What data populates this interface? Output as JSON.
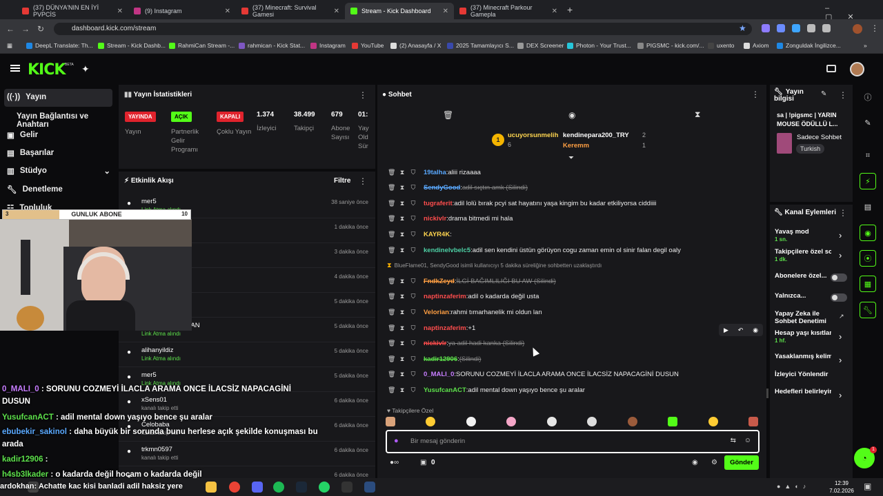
{
  "browser": {
    "tabs": [
      {
        "label": "(37) DÜNYA'NIN EN İYİ PVPCİS",
        "color": "#e53935"
      },
      {
        "label": "(9) Instagram",
        "color": "#c13584"
      },
      {
        "label": "(37) Minecraft: Survival Gamesi",
        "color": "#e53935"
      },
      {
        "label": "Stream - Kick Dashboard",
        "color": "#53fc18"
      },
      {
        "label": "(37) Minecraft Parkour Gamepla",
        "color": "#e53935"
      }
    ],
    "url": "dashboard.kick.com/stream",
    "bookmarks": [
      "DeepL Translate: Th...",
      "Stream - Kick Dashb...",
      "RahmiCan Stream -...",
      "rahmican - Kick Stat...",
      "Instagram",
      "YouTube",
      "(2) Anasayfa / X",
      "2025 Tamamlayıcı S...",
      "DEX Screener",
      "Photon - Your Trust...",
      "PIGSMC - kick.com/...",
      "uxento",
      "Axiom",
      "Zonguldak İngilizce..."
    ]
  },
  "kick": {
    "logo": "KICK",
    "beta": "BETA"
  },
  "nav": {
    "items": [
      "Yayın",
      "Yayın Bağlantısı ve Anahtarı",
      "Gelir",
      "Başarılar",
      "Stüdyo",
      "Denetleme",
      "Topluluk"
    ]
  },
  "overlay": {
    "goal_count": "3",
    "goal_label": "GUNLUK ABONE",
    "goal_target": "10",
    "goal_progress": 0.3
  },
  "stats": {
    "title": "Yayın İstatistikleri",
    "badges": [
      {
        "badge": "YAYINDA",
        "label": "Yayın"
      },
      {
        "badge": "AÇIK",
        "label": "Partnerlik Gelir Programı"
      },
      {
        "badge": "KAPALI",
        "label": "Çoklu Yayın"
      }
    ],
    "numbers": [
      {
        "value": "1.374",
        "label": "İzleyici"
      },
      {
        "value": "38.499",
        "label": "Takipçi"
      },
      {
        "value": "679",
        "label": "Abone Sayısı"
      },
      {
        "value": "01:",
        "label": "Yay Old Sür"
      }
    ]
  },
  "activity": {
    "title": "Etkinlik Akışı",
    "filter": "Filtre",
    "events": [
      {
        "name": "mer5",
        "sub": "Link Atma alındı",
        "time": "38 saniye önce"
      },
      {
        "name": "",
        "sub": "",
        "time": "1 dakika önce"
      },
      {
        "name": "",
        "sub": "",
        "time": "3 dakika önce"
      },
      {
        "name": "",
        "sub": "",
        "time": "4 dakika önce"
      },
      {
        "name": "",
        "sub": "",
        "time": "5 dakika önce"
      },
      {
        "name": "İNANUKLEERATAN",
        "sub": "Link Atma alındı",
        "time": "5 dakika önce"
      },
      {
        "name": "alihanyildiz",
        "sub": "Link Atma alındı",
        "time": "5 dakika önce"
      },
      {
        "name": "mer5",
        "sub": "Link Atma alındı",
        "time": "5 dakika önce"
      },
      {
        "name": "xSens01",
        "sub": "kanalı takip etti",
        "time": "6 dakika önce"
      },
      {
        "name": "Celobaba",
        "sub": "kanalı takip etti",
        "time": "6 dakika önce"
      },
      {
        "name": "trkmn0597",
        "sub": "kanalı takip etti",
        "time": "6 dakika önce"
      },
      {
        "name": "",
        "sub": "",
        "time": "6 dakika önce"
      }
    ]
  },
  "chat": {
    "title": "Sohbet",
    "pinned_left": {
      "name": "ucuyorsunmelih",
      "count": "6"
    },
    "pinned_right": [
      {
        "name": "kendinepara200_TRY",
        "count": "2"
      },
      {
        "name": "Keremm",
        "count": "1"
      }
    ],
    "messages": [
      {
        "user": "19talha",
        "color": "#5aa9ff",
        "text": "aliii rizaaaa",
        "deleted": false
      },
      {
        "user": "SendyGood",
        "color": "#5aa9ff",
        "text": "adil sıçtın amk (Silindi)",
        "deleted": true
      },
      {
        "user": "tugraferit",
        "color": "#ff4d4d",
        "text": "adil lolü bırak pcyi sat hayatını yaşa kingim bu kadar etkiliyorsa ciddiiii",
        "deleted": false
      },
      {
        "user": "nickivlr",
        "color": "#ff4d4d",
        "text": "drama bitmedi mi hala",
        "deleted": false
      },
      {
        "user": "KAYR4K",
        "color": "#ffd54f",
        "text": "",
        "deleted": false
      },
      {
        "user": "kendinelvbelc5",
        "color": "#4dd0a5",
        "text": "adil sen kendini üstün görüyon cogu zaman emin ol sinir falan degil oaly",
        "deleted": false
      },
      {
        "user": "",
        "color": "#aaa",
        "text": "BlueFlame01, SendyGood isimli kullanıcıyı 5 dakika süreliğine sohbetten uzaklaştırdı",
        "deleted": false
      },
      {
        "user": "FndkZeyd",
        "color": "#ff9f43",
        "text": "İLGİ BAĞIMLILIĞI BU AW (Silindi)",
        "deleted": true
      },
      {
        "user": "naptinzaferim",
        "color": "#ff4d4d",
        "text": "adil o kadarda değil usta",
        "deleted": false
      },
      {
        "user": "Velorian",
        "color": "#ff9f43",
        "text": "rahmi tımarhanelik mi oldun lan",
        "deleted": false
      },
      {
        "user": "naptinzaferim",
        "color": "#ff4d4d",
        "text": "+1",
        "deleted": false
      },
      {
        "user": "nickivlr",
        "color": "#ff4d4d",
        "text": "ya adil hadi kanka (Silindi)",
        "deleted": true
      },
      {
        "user": "kadir12906",
        "color": "#5de14b",
        "text": "(Silindi)",
        "deleted": true
      },
      {
        "user": "0_MALI_0",
        "color": "#c77dff",
        "text": "SORUNU COZMEYİ İLACLA ARAMA ONCE İLACSİZ NAPACAGİNİ DUSUN",
        "deleted": false
      },
      {
        "user": "YusufcanACT",
        "color": "#5de14b",
        "text": "adil mental down yaşıyo bence şu aralar",
        "deleted": false
      }
    ],
    "follower_label": "Takipçilere Özel",
    "input_placeholder": "Bir mesaj gönderin",
    "points": "0",
    "send_label": "Gönder"
  },
  "info": {
    "title": "Yayın bilgisi",
    "stream_title": "sa | !pigsmc | YARIN MOUSE ÖDÜLLÜ L...",
    "category": "Sadece Sohbet",
    "language": "Turkish"
  },
  "actions": {
    "title": "Kanal Eylemleri",
    "items": [
      {
        "label": "Yavaş mod",
        "sub": "1 sn.",
        "kind": "arrow"
      },
      {
        "label": "Takipçilere özel soh",
        "sub": "1 dk.",
        "kind": "arrow"
      },
      {
        "label": "Abonelere özel...",
        "sub": "",
        "kind": "toggle"
      },
      {
        "label": "Yalnızca...",
        "sub": "",
        "kind": "toggle"
      },
      {
        "label": "Yapay Zeka ile Sohbet Denetimi",
        "sub": "",
        "kind": "link"
      },
      {
        "label": "Hesap yaşı kısıtlama",
        "sub": "1 hf.",
        "kind": "arrow"
      },
      {
        "label": "Yasaklanmış kelimel",
        "sub": "",
        "kind": "arrow"
      },
      {
        "label": "İzleyici Yönlendir",
        "sub": "",
        "kind": "none"
      },
      {
        "label": "Hedefleri belirleyin",
        "sub": "",
        "kind": "arrow"
      }
    ]
  },
  "overlay_chat": [
    {
      "user": "0_MALI_0",
      "color": "#c77dff",
      "text": "SORUNU COZMEYİ İLACLA ARAMA ONCE İLACSİZ NAPACAGİNİ DUSUN"
    },
    {
      "user": "YusufcanACT",
      "color": "#5de14b",
      "text": "adil mental down yaşıyo bence şu aralar"
    },
    {
      "user": "ebubekir_sakinol",
      "color": "#5aa9ff",
      "text": "daha büyük bir sorunda bunu herlese açık şekilde konuşması bu arada"
    },
    {
      "user": "kadir12906",
      "color": "#5de14b",
      "text": ""
    },
    {
      "user": "h4sb3lkader",
      "color": "#5de14b",
      "text": "o kadarda değil hocam o kadarda değil"
    }
  ],
  "overlay_bottom_text": "ardokhan: Achatte kac kisi banladi adil haksiz yere",
  "taskbar": {
    "time": "12:39",
    "date": "7.02.2026",
    "notification_count": "1"
  }
}
